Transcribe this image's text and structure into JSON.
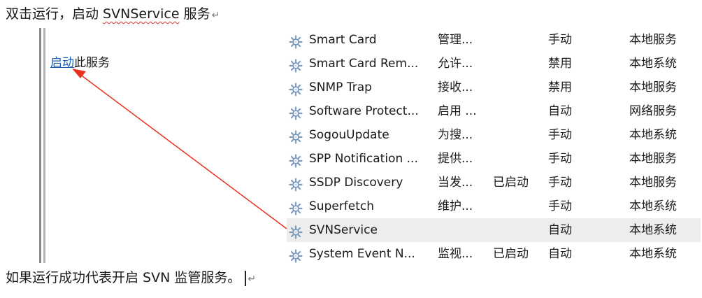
{
  "top_caption": {
    "prefix": "双击运行，启动 ",
    "service_word": "SVNService",
    "suffix": " 服务"
  },
  "bottom_caption": {
    "text": "如果运行成功代表开启 SVN 监管服务。"
  },
  "paragraph_mark": "↵",
  "left_panel": {
    "link_text": "启动",
    "link_suffix": "此服务"
  },
  "services": [
    {
      "name": "Smart Card",
      "desc": "管理...",
      "status": "",
      "startup": "手动",
      "logon": "本地服务",
      "selected": false
    },
    {
      "name": "Smart Card Rem...",
      "desc": "允许...",
      "status": "",
      "startup": "禁用",
      "logon": "本地系统",
      "selected": false
    },
    {
      "name": "SNMP Trap",
      "desc": "接收...",
      "status": "",
      "startup": "禁用",
      "logon": "本地服务",
      "selected": false
    },
    {
      "name": "Software Protect...",
      "desc": "启用 ...",
      "status": "",
      "startup": "自动",
      "logon": "网络服务",
      "selected": false
    },
    {
      "name": "SogouUpdate",
      "desc": "为搜...",
      "status": "",
      "startup": "手动",
      "logon": "本地系统",
      "selected": false
    },
    {
      "name": "SPP Notification ...",
      "desc": "提供...",
      "status": "",
      "startup": "手动",
      "logon": "本地服务",
      "selected": false
    },
    {
      "name": "SSDP Discovery",
      "desc": "当发...",
      "status": "已启动",
      "startup": "手动",
      "logon": "本地服务",
      "selected": false
    },
    {
      "name": "Superfetch",
      "desc": "维护...",
      "status": "",
      "startup": "手动",
      "logon": "本地系统",
      "selected": false
    },
    {
      "name": "SVNService",
      "desc": "",
      "status": "",
      "startup": "自动",
      "logon": "本地系统",
      "selected": true
    },
    {
      "name": "System Event N...",
      "desc": "监视...",
      "status": "已启动",
      "startup": "自动",
      "logon": "本地系统",
      "selected": false
    }
  ],
  "colors": {
    "arrow": "#e8321e",
    "link": "#1a5fb4",
    "selected_row": "#ededed"
  },
  "icons": {
    "service_row": "gear-icon",
    "annotation": "red-arrow"
  }
}
